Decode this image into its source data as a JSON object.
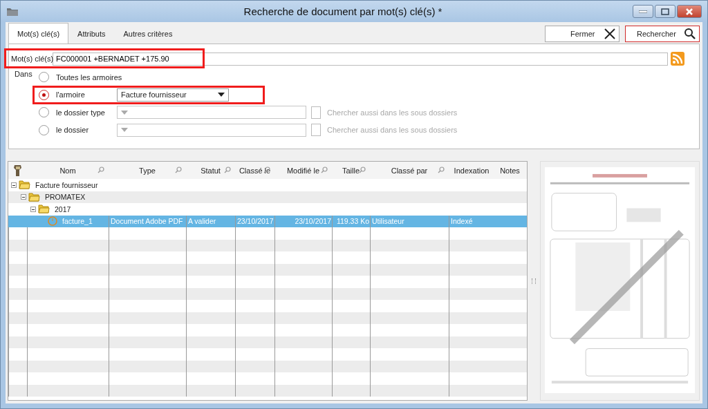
{
  "window": {
    "title": "Recherche de document par mot(s) clé(s) *"
  },
  "tabs": [
    {
      "label": "Mot(s) clé(s)",
      "selected": true
    },
    {
      "label": "Attributs",
      "selected": false
    },
    {
      "label": "Autres critères",
      "selected": false
    }
  ],
  "toolbar": {
    "close_button": "Fermer",
    "search_button": "Rechercher",
    "search_highlighted": true
  },
  "keywords": {
    "label": "Mot(s) clé(s)",
    "value": "FC000001 +BERNADET +175.90",
    "highlighted": true
  },
  "scope": {
    "label": "Dans",
    "options": [
      {
        "label": "Toutes les armoires",
        "selected": false,
        "kind": "plain"
      },
      {
        "label": "l'armoire",
        "selected": true,
        "kind": "combo",
        "value": "Facture fournisseur",
        "disabled": false,
        "highlighted": true
      },
      {
        "label": "le dossier type",
        "selected": false,
        "kind": "combo-check",
        "disabled": true,
        "check_label": "Chercher aussi dans les sous dossiers",
        "checked": false
      },
      {
        "label": "le dossier",
        "selected": false,
        "kind": "combo-check",
        "disabled": true,
        "check_label": "Chercher aussi dans les sous dossiers",
        "checked": false
      }
    ]
  },
  "table": {
    "columns": [
      {
        "kind": "icon",
        "filter": false
      },
      {
        "label": "Nom",
        "kind": "text",
        "filter": true
      },
      {
        "label": "Type",
        "kind": "text",
        "filter": true
      },
      {
        "label": "Statut",
        "kind": "text",
        "filter": true
      },
      {
        "label": "Classé le",
        "kind": "text",
        "filter": true
      },
      {
        "label": "Modifié le",
        "kind": "text",
        "filter": true
      },
      {
        "label": "Taille",
        "kind": "text",
        "filter": true
      },
      {
        "label": "Classé par",
        "kind": "text",
        "filter": true
      },
      {
        "label": "Indexation",
        "kind": "text",
        "filter": false
      },
      {
        "label": "Notes",
        "kind": "text",
        "filter": false
      }
    ],
    "rows": [
      {
        "kind": "folder",
        "name": "Facture fournisseur",
        "expanded": true,
        "selected": false,
        "children": [
          {
            "kind": "folder",
            "name": "PROMATEX",
            "expanded": true,
            "selected": false,
            "children": [
              {
                "kind": "folder",
                "name": "2017",
                "expanded": true,
                "selected": false,
                "children": [
                  {
                    "kind": "document",
                    "name": "facture_1",
                    "selected": true,
                    "cells": [
                      "Document Adobe PDF",
                      "A valider",
                      "23/10/2017",
                      "23/10/2017",
                      "119.33 Ko",
                      "Utilisateur",
                      "Indexé"
                    ]
                  }
                ]
              }
            ]
          }
        ]
      }
    ]
  }
}
